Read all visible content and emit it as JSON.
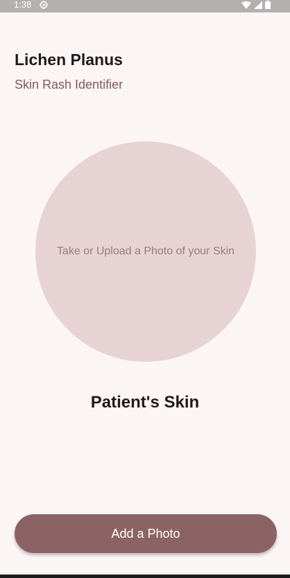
{
  "status_bar": {
    "time": "1:38",
    "left_icon": "settings-gear-icon",
    "right_icons": [
      "wifi-icon",
      "cellular-signal-icon",
      "battery-icon"
    ]
  },
  "header": {
    "title": "Lichen Planus",
    "subtitle": "Skin Rash Identifier"
  },
  "photo_area": {
    "prompt": "Take or Upload a Photo of your Skin"
  },
  "section": {
    "title": "Patient's Skin"
  },
  "actions": {
    "add_photo_label": "Add a Photo"
  },
  "colors": {
    "background": "#fcf5f5",
    "primary": "#8c6365",
    "circle": "#e8d3d4",
    "subtitle": "#7d5a5d"
  }
}
